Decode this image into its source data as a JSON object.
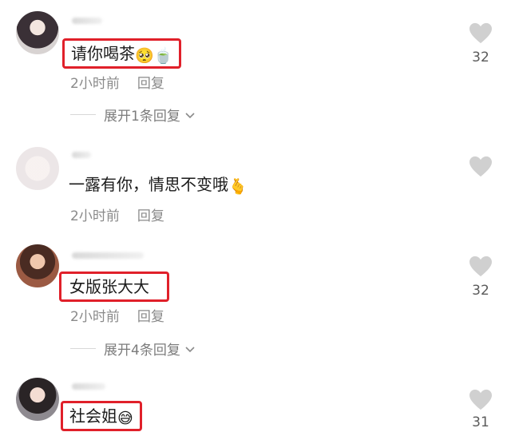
{
  "comments": [
    {
      "text": "请你喝茶",
      "emojis": [
        "🥺",
        "🍵"
      ],
      "time": "2小时前",
      "reply_label": "回复",
      "expand_label": "展开1条回复",
      "likes": "32",
      "highlighted": true
    },
    {
      "text": "一露有你，情思不变哦",
      "emojis": [
        "🫰"
      ],
      "time": "2小时前",
      "reply_label": "回复",
      "likes": "",
      "highlighted": false
    },
    {
      "text": "女版张大大",
      "emojis": [],
      "time": "2小时前",
      "reply_label": "回复",
      "expand_label": "展开4条回复",
      "likes": "32",
      "highlighted": true
    },
    {
      "text": "社会姐",
      "emojis": [
        "😅"
      ],
      "likes": "31",
      "highlighted": true
    }
  ],
  "colors": {
    "highlight_border": "#e0202a",
    "meta_text": "#8a8a8a",
    "like_icon": "#d0d0d0"
  },
  "icons": {
    "like": "heart-icon",
    "expand": "chevron-down-icon"
  }
}
